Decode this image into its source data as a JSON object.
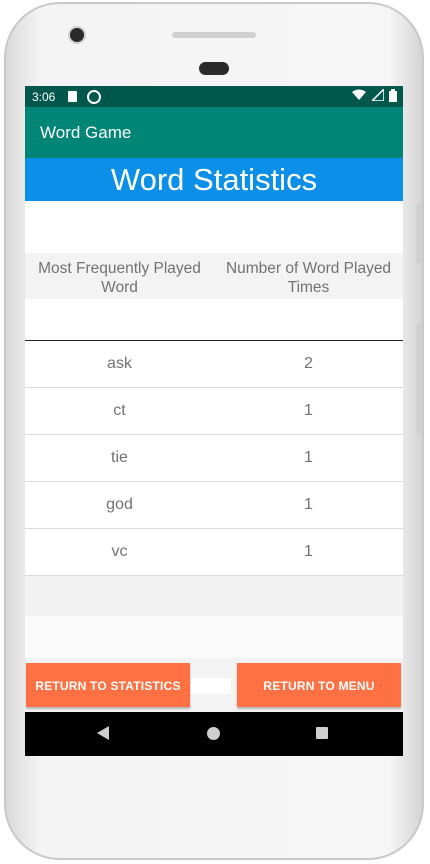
{
  "status_bar": {
    "time": "3:06",
    "icons": [
      "sd-card-icon",
      "sync-icon",
      "wifi-icon",
      "signal-icon",
      "battery-icon"
    ]
  },
  "app_bar": {
    "title": "Word Game"
  },
  "banner": {
    "title": "Word Statistics",
    "color": "#0b8fe8"
  },
  "table": {
    "headers": [
      "Most Frequently Played Word",
      "Number of Word Played Times"
    ],
    "rows": [
      {
        "word": "ask",
        "count": "2"
      },
      {
        "word": "ct",
        "count": "1"
      },
      {
        "word": "tie",
        "count": "1"
      },
      {
        "word": "god",
        "count": "1"
      },
      {
        "word": "vc",
        "count": "1"
      }
    ]
  },
  "buttons": {
    "return_statistics": "RETURN TO STATISTICS",
    "return_menu": "RETURN TO MENU",
    "color": "#ff7043"
  },
  "nav": {
    "icons": [
      "back-icon",
      "home-icon",
      "recents-icon"
    ]
  },
  "colors": {
    "status_bar": "#00574b",
    "app_bar": "#008577"
  }
}
